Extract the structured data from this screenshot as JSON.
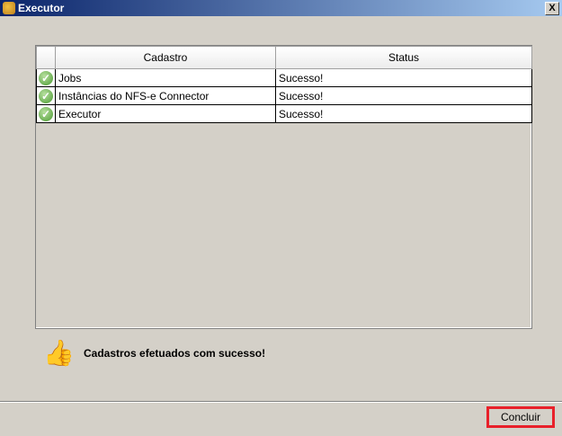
{
  "window": {
    "title": "Executor",
    "close": "X"
  },
  "table": {
    "columns": [
      "Cadastro",
      "Status"
    ],
    "rows": [
      {
        "cadastro": "Jobs",
        "status": "Sucesso!"
      },
      {
        "cadastro": "Instâncias do NFS-e Connector",
        "status": "Sucesso!"
      },
      {
        "cadastro": "Executor",
        "status": "Sucesso!"
      }
    ]
  },
  "message": "Cadastros efetuados com sucesso!",
  "button": "Concluir"
}
